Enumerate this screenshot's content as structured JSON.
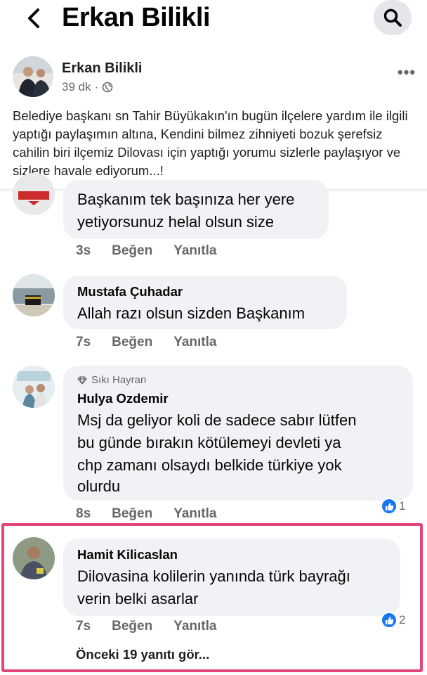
{
  "header": {
    "title": "Erkan Bilikli"
  },
  "post": {
    "author": "Erkan Bilikli",
    "time": "39 dk",
    "separator": "·",
    "more": "•••",
    "text": "Belediye başkanı sn Tahir Büyükakın'ın bugün ilçelere yardım ile ilgili yaptığı paylaşımın altına, Kendini bilmez zihniyeti bozuk şerefsiz cahilin biri ilçemiz Dilovası için yaptığı yorumu sizlerle paylaşıyor ve sizlere havale ediyorum...!"
  },
  "comments": [
    {
      "author": "",
      "lines": [
        "Başkanım tek başınıza her yere",
        "yetiyorsunuz helal olsun size"
      ],
      "time": "3s",
      "like": "Beğen",
      "reply": "Yanıtla"
    },
    {
      "author": "Mustafa Çuhadar",
      "lines": [
        "Allah razı olsun sizden Başkanım"
      ],
      "time": "7s",
      "like": "Beğen",
      "reply": "Yanıtla"
    },
    {
      "badge": "Sıkı Hayran",
      "author": "Hulya Ozdemir",
      "lines": [
        "Msj da geliyor koli de sadece sabır lütfen",
        "bu günde bırakın  kötülemeyi devleti ya",
        "chp zamanı olsaydı belkide türkiye yok",
        "olurdu"
      ],
      "time": "8s",
      "like": "Beğen",
      "reply": "Yanıtla",
      "reactions": "1"
    },
    {
      "author": "Hamit Kilicaslan",
      "lines": [
        "Dilovasina kolilerin yanında türk bayrağı",
        "verin belki asarlar"
      ],
      "time": "7s",
      "like": "Beğen",
      "reply": "Yanıtla",
      "reactions": "2"
    }
  ],
  "previous_replies": "Önceki 19 yanıtı gör...",
  "colors": {
    "highlight": "#e0457b",
    "like_blue": "#1877f2",
    "bubble": "#f0f2f5"
  }
}
